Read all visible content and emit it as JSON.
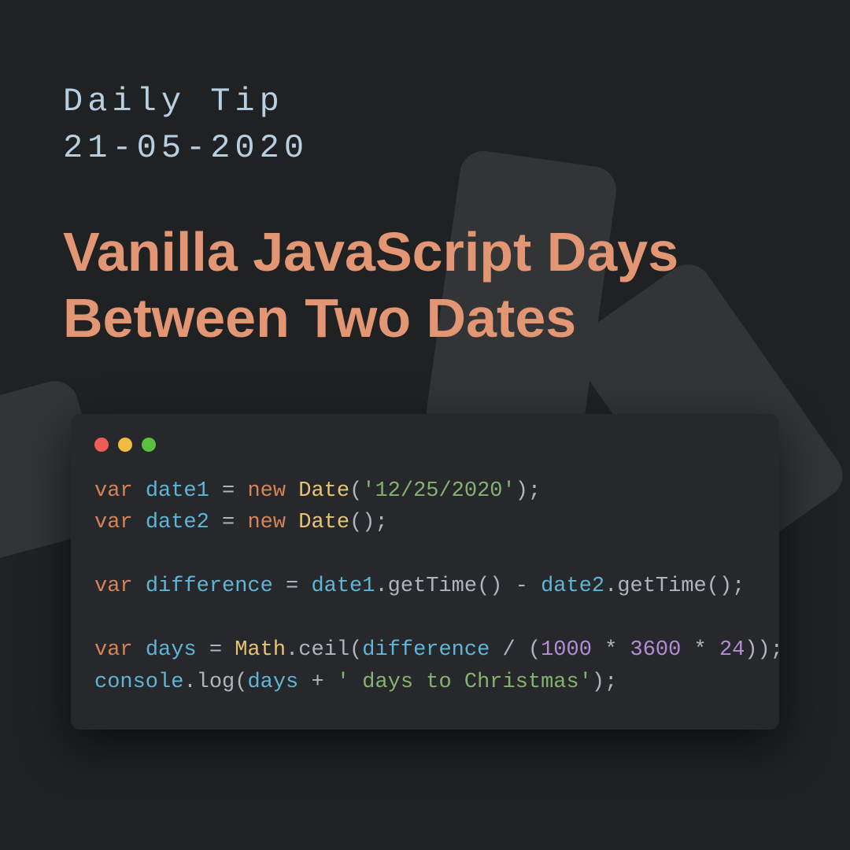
{
  "header": {
    "label": "Daily Tip",
    "date": "21-05-2020"
  },
  "title": "Vanilla JavaScript Days Between Two Dates",
  "code": {
    "line1": {
      "kw": "var",
      "v": "date1",
      "eq": " = ",
      "nw": "new",
      "cls": "Date",
      "args": "'12/25/2020'",
      "end": ";"
    },
    "line2": {
      "kw": "var",
      "v": "date2",
      "eq": " = ",
      "nw": "new",
      "cls": "Date",
      "args": "",
      "end": "();"
    },
    "line3": {
      "kw": "var",
      "v": "difference",
      "eq": " = ",
      "a": "date1",
      "m1": ".getTime() - ",
      "b": "date2",
      "m2": ".getTime();"
    },
    "line4": {
      "kw": "var",
      "v": "days",
      "eq": " = ",
      "cls": "Math",
      "fn": ".ceil(",
      "arg": "difference",
      "div": " / (",
      "n1": "1000",
      "s1": " * ",
      "n2": "3600",
      "s2": " * ",
      "n3": "24",
      "end": "));"
    },
    "line5": {
      "obj": "console",
      "fn": ".log(",
      "arg": "days",
      "plus": " + ",
      "str": "' days to Christmas'",
      "end": ");"
    }
  }
}
